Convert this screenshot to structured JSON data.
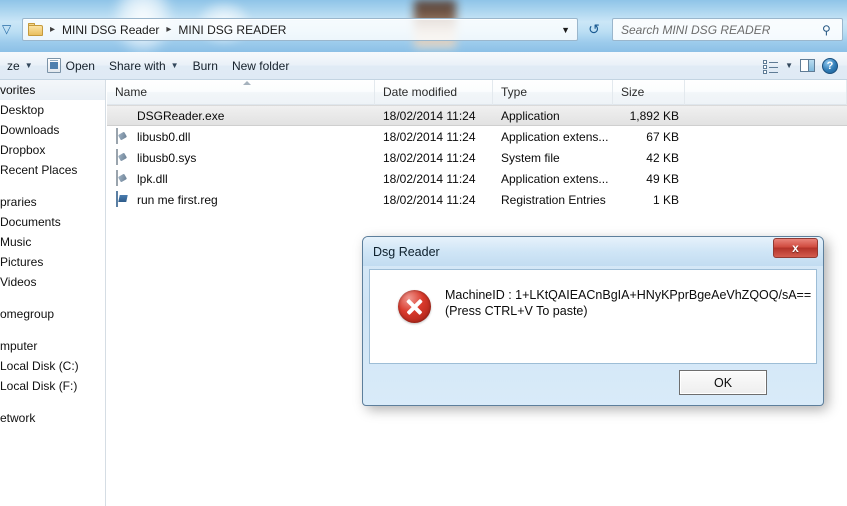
{
  "window": {
    "address": {
      "crumbs": [
        "MINI DSG Reader",
        "MINI DSG READER"
      ],
      "separator": "▸",
      "dropdown_caret": "▼",
      "refresh_glyph": "↺"
    },
    "search": {
      "placeholder": "Search MINI DSG READER",
      "icon_glyph": "⚲"
    },
    "back_glyph": "▽"
  },
  "toolbar": {
    "organize_label": "ze",
    "organize_caret": "▼",
    "open_label": "Open",
    "share_with_label": "Share with",
    "share_caret": "▼",
    "burn_label": "Burn",
    "new_folder_label": "New folder",
    "view_caret": "▼",
    "help_glyph": "?"
  },
  "sidebar": {
    "groups": [
      {
        "header": "vorites",
        "items": [
          "Desktop",
          "Downloads",
          "Dropbox",
          "Recent Places"
        ]
      },
      {
        "header": "praries",
        "items": [
          "Documents",
          "Music",
          "Pictures",
          "Videos"
        ]
      },
      {
        "header": "omegroup",
        "items": []
      },
      {
        "header": "mputer",
        "items": [
          "Local Disk (C:)",
          "Local Disk (F:)"
        ]
      },
      {
        "header": "etwork",
        "items": []
      }
    ]
  },
  "filelist": {
    "columns": [
      "Name",
      "Date modified",
      "Type",
      "Size"
    ],
    "rows": [
      {
        "name": "DSGReader.exe",
        "date": "18/02/2014 11:24",
        "type": "Application",
        "size": "1,892 KB",
        "icon": "exe-sphere-icon",
        "selected": true
      },
      {
        "name": "libusb0.dll",
        "date": "18/02/2014 11:24",
        "type": "Application extens...",
        "size": "67 KB",
        "icon": "dll-file-icon",
        "selected": false
      },
      {
        "name": "libusb0.sys",
        "date": "18/02/2014 11:24",
        "type": "System file",
        "size": "42 KB",
        "icon": "dll-file-icon",
        "selected": false
      },
      {
        "name": "lpk.dll",
        "date": "18/02/2014 11:24",
        "type": "Application extens...",
        "size": "49 KB",
        "icon": "dll-file-icon",
        "selected": false
      },
      {
        "name": "run me first.reg",
        "date": "18/02/2014 11:24",
        "type": "Registration Entries",
        "size": "1 KB",
        "icon": "registry-file-icon",
        "selected": false
      }
    ]
  },
  "dialog": {
    "title": "Dsg Reader",
    "close_label": "x",
    "message_line1": "MachineID : 1+LKtQAIEACnBgIA+HNyKPprBgeAeVhZQOQ/sA==",
    "message_line2": "(Press CTRL+V To paste)",
    "ok_label": "OK"
  },
  "colors": {
    "title_blue": "#8fc4e8",
    "error_red": "#d93a2c",
    "close_red": "#cf4a3e",
    "exe_green": "#2f8a3c"
  }
}
